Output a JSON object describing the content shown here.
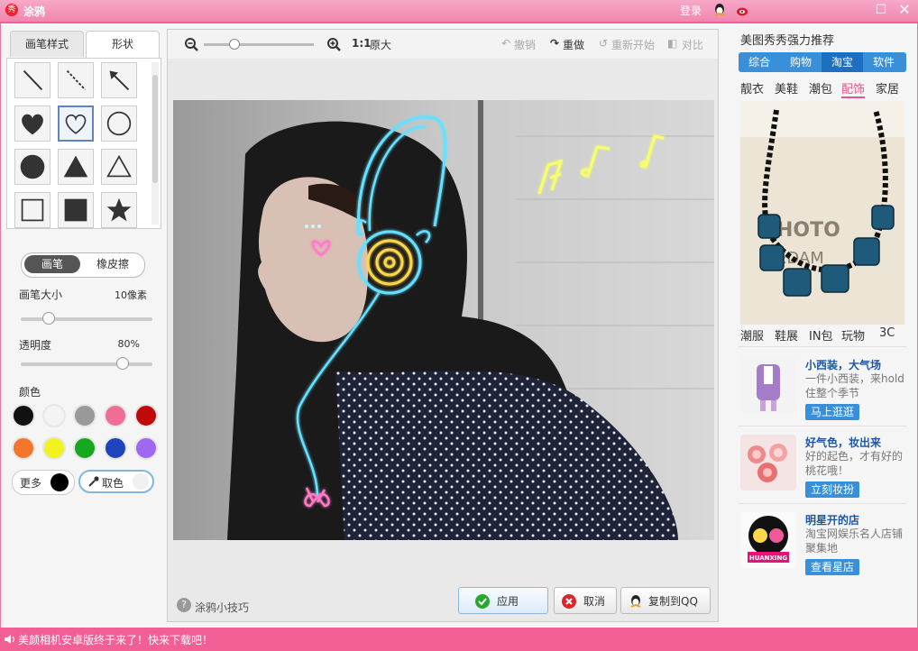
{
  "window": {
    "title": "涂鸦",
    "login": "登录"
  },
  "left_panel": {
    "tabs": [
      "画笔样式",
      "形状"
    ],
    "shapes": [
      "line",
      "dashed-line",
      "arrow",
      "heart-filled",
      "heart-outline",
      "circle-outline",
      "circle-filled",
      "triangle-filled",
      "triangle-outline",
      "square-outline",
      "square-filled",
      "star-filled"
    ],
    "selected_shape": "heart-outline",
    "mode": {
      "pen": "画笔",
      "eraser": "橡皮擦",
      "active": "画笔"
    },
    "brush_size": {
      "label": "画笔大小",
      "value": "10像素",
      "level": 0.18
    },
    "opacity": {
      "label": "透明度",
      "value": "80%",
      "level": 0.8
    },
    "color_label": "颜色",
    "colors": [
      "#111111",
      "#f4f4f4",
      "#999999",
      "#f06d95",
      "#c00a0a",
      "#f4762d",
      "#f2f21e",
      "#16a81e",
      "#1d44bd",
      "#9e68f0"
    ],
    "more_label": "更多",
    "current_color": "#000000",
    "pick_label": "取色"
  },
  "toolbar": {
    "zoom_level": 0.25,
    "actual_size_prefix": "1:1",
    "actual_size": "原大",
    "undo": "撤销",
    "redo": "重做",
    "restart": "重新开始",
    "compare": "对比"
  },
  "center": {
    "tip": "涂鸦小技巧",
    "apply": "应用",
    "cancel": "取消",
    "copy_qq": "复制到QQ"
  },
  "right_panel": {
    "title": "美图秀秀强力推荐",
    "tabs": [
      "综合",
      "购物",
      "淘宝",
      "软件"
    ],
    "active_tab": "淘宝",
    "subcats": [
      "靓衣",
      "美鞋",
      "潮包",
      "配饰",
      "家居"
    ],
    "active_subcat": "配饰",
    "subcats2": [
      "潮服",
      "鞋展",
      "IN包",
      "玩物",
      "3C"
    ],
    "promos": [
      {
        "title": "小西装，大气场",
        "desc": "一件小西装，来hold住整个季节",
        "button": "马上逛逛"
      },
      {
        "title": "好气色，妆出来",
        "desc": "好的起色，才有好的桃花哦！",
        "button": "立刻妆扮"
      },
      {
        "title": "明星开的店",
        "desc": "淘宝网娱乐名人店铺聚集地",
        "button": "查看星店"
      }
    ],
    "brand_logo_text": "HUANXING"
  },
  "status": {
    "message": "美颜相机安卓版终于来了！快来下载吧！"
  }
}
